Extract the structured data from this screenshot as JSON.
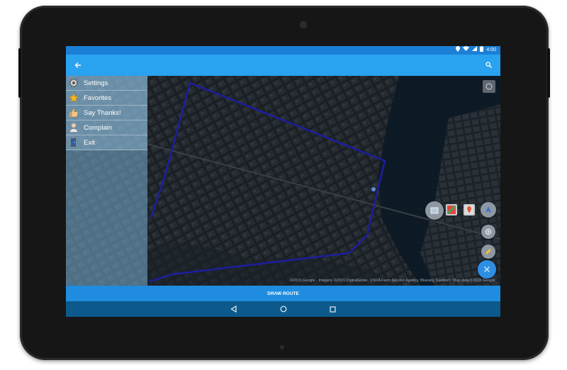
{
  "status_bar": {
    "time": "4:00"
  },
  "app_bar": {
    "back_icon": "arrow-left-icon",
    "search_icon": "search-icon"
  },
  "drawer": {
    "items": [
      {
        "label": "Settings",
        "icon": "gear-icon"
      },
      {
        "label": "Favorites",
        "icon": "star-icon"
      },
      {
        "label": "Say Thanks!",
        "icon": "thumbs-up-icon"
      },
      {
        "label": "Complain",
        "icon": "person-icon"
      },
      {
        "label": "Exit",
        "icon": "door-icon"
      }
    ]
  },
  "map": {
    "attribution": "©2015 Google · Imagery ©2015 DigitalGlobe, USDA Farm Service Agency, Bluesky, Sanborn, Map data ©2015 Google"
  },
  "bottom": {
    "draw_route_label": "DRAW ROUTE"
  },
  "colors": {
    "status_bar": "#1c7fd6",
    "app_bar": "#29a2f0",
    "draw_route": "#1f8ce0",
    "nav_bar": "#0c5a8c",
    "route_line": "#1e1e9e"
  }
}
